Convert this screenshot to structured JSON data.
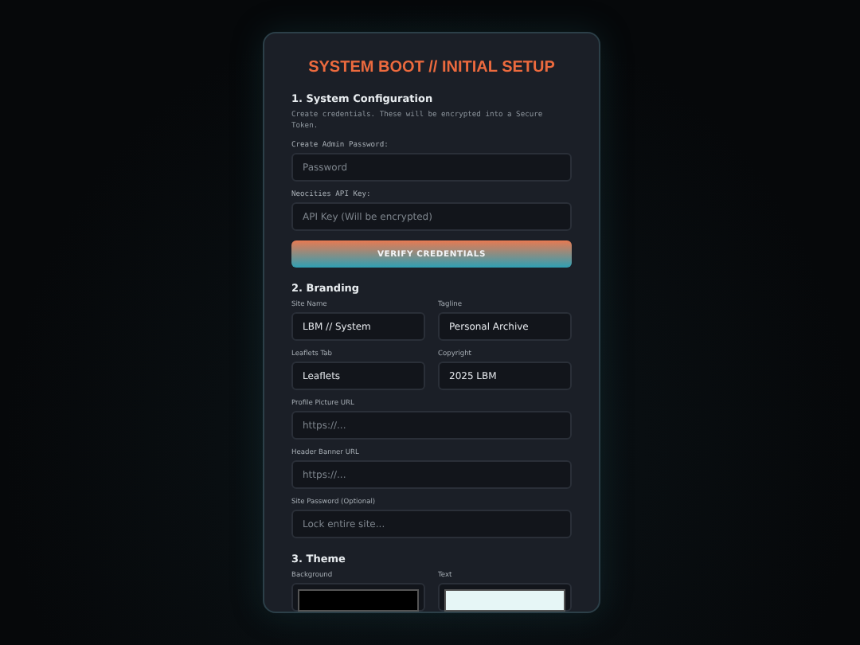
{
  "modal": {
    "title": "SYSTEM BOOT // INITIAL SETUP",
    "sections": [
      {
        "heading": "1. System Configuration",
        "description": "Create credentials. These will be encrypted into a Secure Token.",
        "fields": [
          {
            "label": "Create Admin Password:",
            "kind": "mono",
            "placeholder": "Password"
          },
          {
            "label": "Neocities API Key:",
            "kind": "mono",
            "placeholder": "API Key (Will be encrypted)"
          }
        ],
        "button": "VERIFY CREDENTIALS"
      },
      {
        "heading": "2. Branding",
        "fields": [
          {
            "label": "Site Name",
            "kind": "half",
            "value": "LBM // System"
          },
          {
            "label": "Tagline",
            "kind": "half",
            "value": "Personal Archive"
          },
          {
            "label": "Leaflets Tab",
            "kind": "half",
            "value": "Leaflets"
          },
          {
            "label": "Copyright",
            "kind": "half",
            "value": "2025 LBM"
          },
          {
            "label": "Profile Picture URL",
            "kind": "full",
            "placeholder": "https://..."
          },
          {
            "label": "Header Banner URL",
            "kind": "full",
            "placeholder": "https://..."
          },
          {
            "label": "Site Password (Optional)",
            "kind": "full",
            "placeholder": "Lock entire site..."
          }
        ]
      },
      {
        "heading": "3. Theme",
        "fields": [
          {
            "label": "Background",
            "kind": "color",
            "color": "#000000"
          },
          {
            "label": "Text",
            "kind": "color",
            "color": "#e6f6f6"
          }
        ]
      }
    ]
  }
}
